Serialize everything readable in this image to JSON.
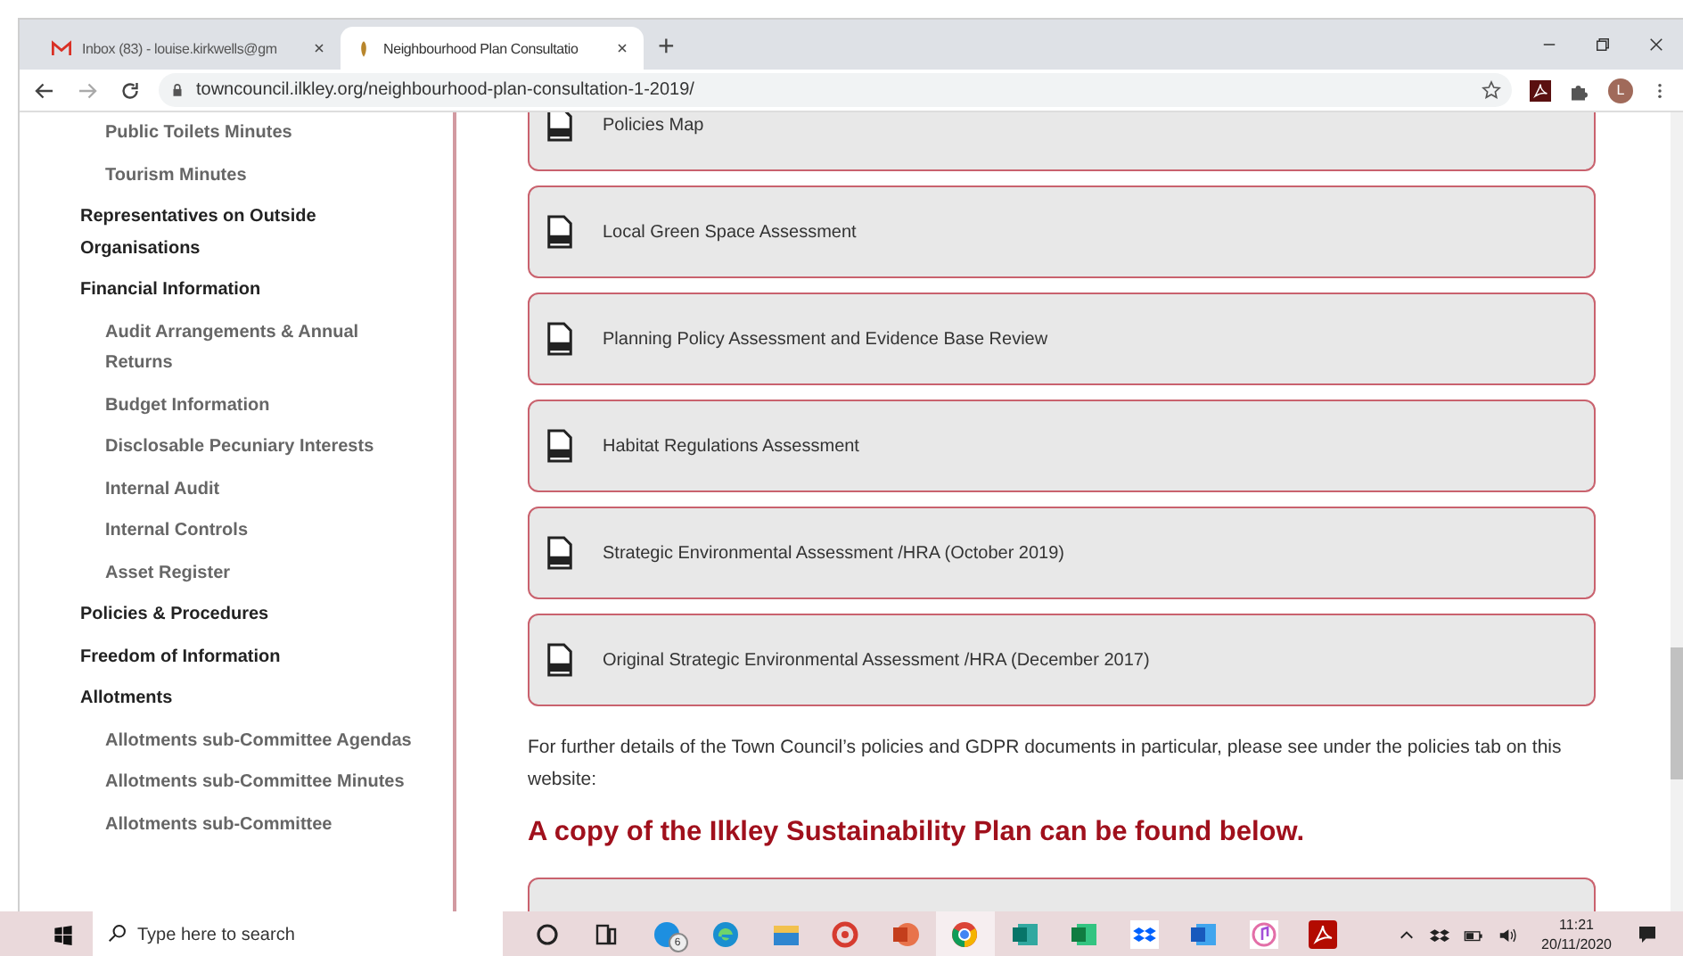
{
  "browser": {
    "tabs": [
      {
        "title": "Inbox (83) - louise.kirkwells@gm",
        "kind": "mail",
        "selected": false
      },
      {
        "title": "Neighbourhood Plan Consultatio",
        "kind": "crest",
        "selected": true
      }
    ],
    "new_tab": "+",
    "url": "towncouncil.ilkley.org/neighbourhood-plan-consultation-1-2019/",
    "avatar": "L"
  },
  "sidebar": {
    "items": [
      {
        "children": [
          {
            "label": "Public Toilets Minutes"
          },
          {
            "label": "Tourism Minutes"
          }
        ]
      },
      {
        "label": "Representatives on Outside Organisations"
      },
      {
        "label": "Financial Information",
        "children": [
          {
            "label": "Audit Arrangements & Annual Returns"
          },
          {
            "label": "Budget Information"
          },
          {
            "label": "Disclosable Pecuniary Interests"
          },
          {
            "label": "Internal Audit"
          },
          {
            "label": "Internal Controls"
          },
          {
            "label": "Asset Register"
          }
        ]
      },
      {
        "label": "Policies & Procedures"
      },
      {
        "label": "Freedom of Information"
      },
      {
        "label": "Allotments",
        "children": [
          {
            "label": "Allotments sub-Committee Agendas"
          },
          {
            "label": "Allotments sub-Committee Minutes"
          },
          {
            "label": "Allotments sub-Committee"
          }
        ]
      }
    ]
  },
  "documents": [
    {
      "title": "Policies Map"
    },
    {
      "title": "Local Green Space Assessment"
    },
    {
      "title": "Planning Policy Assessment and Evidence Base Review"
    },
    {
      "title": "Habitat Regulations Assessment"
    },
    {
      "title": "Strategic Environmental Assessment /HRA (October 2019)"
    },
    {
      "title": "Original Strategic Environmental Assessment /HRA (December 2017)"
    }
  ],
  "note": "For further details of the Town Council’s policies and GDPR documents in particular, please see under the policies tab on this website:",
  "heading": "A copy of the Ilkley Sustainability Plan can be found below.",
  "taskbar": {
    "search": {
      "placeholder": "Type here to search"
    },
    "apps": [
      {
        "kind": "cortana",
        "selected": false
      },
      {
        "kind": "taskview",
        "selected": false
      },
      {
        "kind": "skype",
        "badge": "6",
        "selected": false
      },
      {
        "kind": "edge",
        "selected": false
      },
      {
        "kind": "folder",
        "selected": false
      },
      {
        "kind": "ring",
        "selected": false
      },
      {
        "kind": "powerpoint",
        "selected": false
      },
      {
        "kind": "chrome",
        "selected": true
      },
      {
        "kind": "publisher",
        "selected": false
      },
      {
        "kind": "excel",
        "selected": false
      },
      {
        "kind": "dropbox",
        "selected": false
      },
      {
        "kind": "word",
        "selected": false
      },
      {
        "kind": "music",
        "selected": false
      },
      {
        "kind": "acrobat",
        "selected": false
      }
    ],
    "time": "11:21",
    "date": "20/11/2020"
  }
}
